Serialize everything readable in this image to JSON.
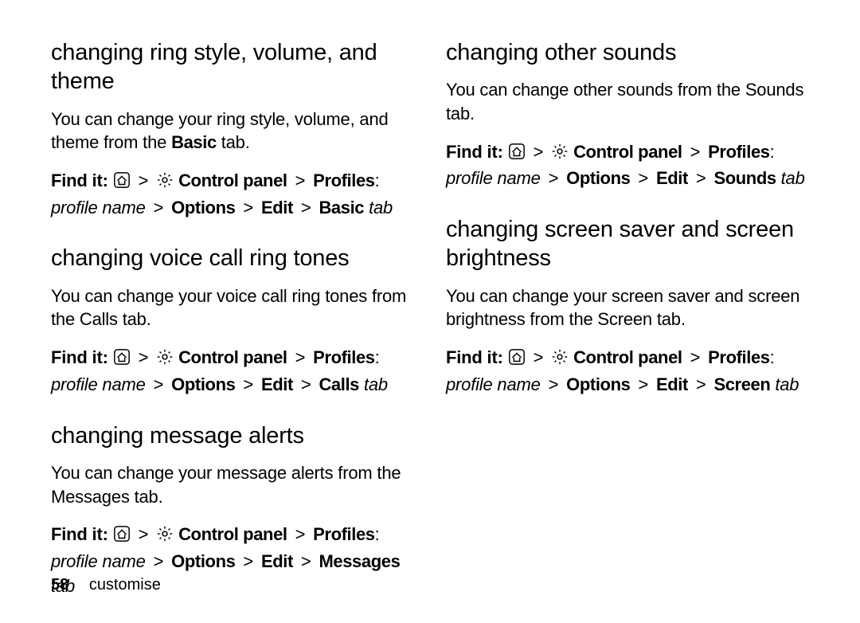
{
  "footer": {
    "page_number": "58",
    "section": "customise"
  },
  "common": {
    "find_it_label": "Find it:",
    "gt": ">",
    "control_panel": "Control panel",
    "profiles_label": "Profiles",
    "profile_name": "profile name",
    "options": "Options",
    "edit": "Edit",
    "tab_word": "tab"
  },
  "left": {
    "s1": {
      "heading": "changing ring style, volume, and theme",
      "body_pre": "You can change your ring style, volume, and theme from the ",
      "body_bold": "Basic",
      "body_post": " tab.",
      "last_tab": "Basic"
    },
    "s2": {
      "heading": "changing voice call ring tones",
      "body": "You can change your voice call ring tones from the Calls tab.",
      "last_tab": "Calls"
    },
    "s3": {
      "heading": "changing message alerts",
      "body": "You can change your message alerts from the Messages tab.",
      "last_tab": "Messages"
    }
  },
  "right": {
    "s1": {
      "heading": "changing other sounds",
      "body": "You can change other sounds from the Sounds tab.",
      "last_tab": "Sounds"
    },
    "s2": {
      "heading": "changing screen saver and screen brightness",
      "body": "You can change your screen saver and screen brightness from the Screen tab.",
      "last_tab": "Screen"
    }
  }
}
